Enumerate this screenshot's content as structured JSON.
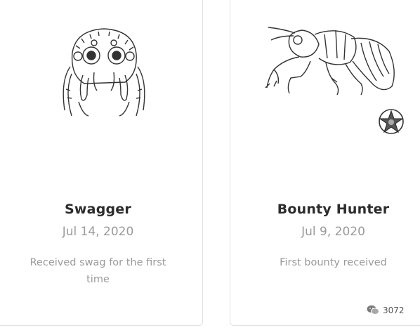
{
  "badges": [
    {
      "title": "Swagger",
      "date": "Jul 14, 2020",
      "description": "Received swag for the first time",
      "icon": "jumping-spider-icon"
    },
    {
      "title": "Bounty Hunter",
      "date": "Jul 9, 2020",
      "description": "First bounty received",
      "icon": "cicada-icon",
      "extra_icon": "sheriff-star-icon"
    }
  ],
  "watermark": {
    "icon": "wechat-icon",
    "text": "3072"
  }
}
